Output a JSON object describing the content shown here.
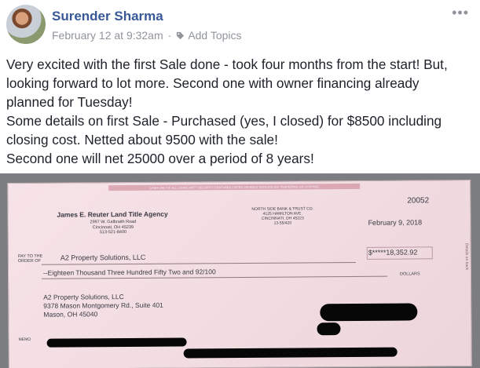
{
  "post": {
    "author": "Surender Sharma",
    "timestamp": "February 12 at 9:32am",
    "separator": "·",
    "add_topics": "Add Topics",
    "more_label": "•••",
    "body_lines": [
      "Very excited with the first Sale done - took four months from the start! But,",
      "looking forward to lot more. Second one with owner financing already",
      "planned for Tuesday!",
      "Some details on first Sale - Purchased (yes, I closed) for $8500 including",
      "closing cost. Netted about 9500 with the sale!",
      "Second one will net 25000 over a period of 8 years!"
    ]
  },
  "check": {
    "banner": "CASH ONLY IF ALL CHARLIAN™ SECURITY FEATURES LISTED ON BACK INDICATE NO TAMPERING OR COPYING",
    "drawer_name": "James E. Reuter Land Title Agency",
    "drawer_address": [
      "2997 W. Galbraith Road",
      "Cincinnati, OH 45239",
      "513-521-8400"
    ],
    "bank": [
      "NORTH SIDE BANK & TRUST CO.",
      "4125 HAMILTON AVE.",
      "CINCINNATI, OH 45223",
      "13-55/420"
    ],
    "check_number": "20052",
    "date": "February 9, 2018",
    "pay_to_label": [
      "PAY TO THE",
      "ORDER OF"
    ],
    "payee": "A2 Property Solutions, LLC",
    "amount": "$*****18,352.92",
    "amount_words": "--Eighteen Thousand Three Hundred Fifty Two and 92/100",
    "dollars_label": "DOLLARS",
    "payee_address": [
      "A2 Property Solutions, LLC",
      "9378 Mason Montgomery Rd., Suite 401",
      "Mason, OH 45040"
    ],
    "memo_label": "MEMO",
    "side_text": "Details on back"
  }
}
